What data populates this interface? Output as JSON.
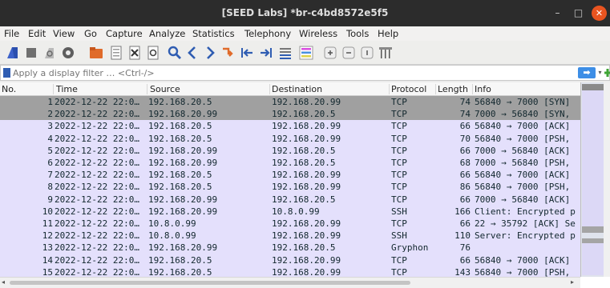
{
  "window": {
    "title": "[SEED Labs] *br-c4bd8572e5f5",
    "minimize_glyph": "–",
    "maximize_glyph": "□",
    "close_glyph": "✕"
  },
  "menu": [
    "File",
    "Edit",
    "View",
    "Go",
    "Capture",
    "Analyze",
    "Statistics",
    "Telephony",
    "Wireless",
    "Tools",
    "Help"
  ],
  "toolbar": {
    "icons": [
      "start-capture-icon",
      "stop-capture-icon",
      "restart-capture-icon",
      "capture-options-icon",
      "open-file-icon",
      "save-file-icon",
      "close-file-icon",
      "reload-file-icon",
      "find-packet-icon",
      "go-back-icon",
      "go-forward-icon",
      "go-to-packet-icon",
      "go-first-packet-icon",
      "go-last-packet-icon",
      "auto-scroll-icon",
      "colorize-icon",
      "zoom-in-icon",
      "zoom-out-icon",
      "normal-size-icon",
      "resize-columns-icon"
    ]
  },
  "filter": {
    "placeholder": "Apply a display filter … <Ctrl-/>",
    "value": "",
    "apply_glyph": "➡",
    "dropdown_glyph": "▾"
  },
  "packet_list": {
    "columns": [
      "No.",
      "Time",
      "Source",
      "Destination",
      "Protocol",
      "Length",
      "Info"
    ],
    "rows": [
      {
        "no": "1",
        "time": "2022-12-22 22:0…",
        "source": "192.168.20.5",
        "destination": "192.168.20.99",
        "protocol": "TCP",
        "length": "74",
        "info": "56840 → 7000 [SYN]",
        "selected": true
      },
      {
        "no": "2",
        "time": "2022-12-22 22:0…",
        "source": "192.168.20.99",
        "destination": "192.168.20.5",
        "protocol": "TCP",
        "length": "74",
        "info": "7000 → 56840 [SYN,",
        "selected": true
      },
      {
        "no": "3",
        "time": "2022-12-22 22:0…",
        "source": "192.168.20.5",
        "destination": "192.168.20.99",
        "protocol": "TCP",
        "length": "66",
        "info": "56840 → 7000 [ACK]"
      },
      {
        "no": "4",
        "time": "2022-12-22 22:0…",
        "source": "192.168.20.5",
        "destination": "192.168.20.99",
        "protocol": "TCP",
        "length": "70",
        "info": "56840 → 7000 [PSH,"
      },
      {
        "no": "5",
        "time": "2022-12-22 22:0…",
        "source": "192.168.20.99",
        "destination": "192.168.20.5",
        "protocol": "TCP",
        "length": "66",
        "info": "7000 → 56840 [ACK]"
      },
      {
        "no": "6",
        "time": "2022-12-22 22:0…",
        "source": "192.168.20.99",
        "destination": "192.168.20.5",
        "protocol": "TCP",
        "length": "68",
        "info": "7000 → 56840 [PSH,"
      },
      {
        "no": "7",
        "time": "2022-12-22 22:0…",
        "source": "192.168.20.5",
        "destination": "192.168.20.99",
        "protocol": "TCP",
        "length": "66",
        "info": "56840 → 7000 [ACK]"
      },
      {
        "no": "8",
        "time": "2022-12-22 22:0…",
        "source": "192.168.20.5",
        "destination": "192.168.20.99",
        "protocol": "TCP",
        "length": "86",
        "info": "56840 → 7000 [PSH,"
      },
      {
        "no": "9",
        "time": "2022-12-22 22:0…",
        "source": "192.168.20.99",
        "destination": "192.168.20.5",
        "protocol": "TCP",
        "length": "66",
        "info": "7000 → 56840 [ACK]"
      },
      {
        "no": "10",
        "time": "2022-12-22 22:0…",
        "source": "192.168.20.99",
        "destination": "10.8.0.99",
        "protocol": "SSH",
        "length": "166",
        "info": "Client: Encrypted p"
      },
      {
        "no": "11",
        "time": "2022-12-22 22:0…",
        "source": "10.8.0.99",
        "destination": "192.168.20.99",
        "protocol": "TCP",
        "length": "66",
        "info": "22 → 35792 [ACK] Se"
      },
      {
        "no": "12",
        "time": "2022-12-22 22:0…",
        "source": "10.8.0.99",
        "destination": "192.168.20.99",
        "protocol": "SSH",
        "length": "110",
        "info": "Server: Encrypted p"
      },
      {
        "no": "13",
        "time": "2022-12-22 22:0…",
        "source": "192.168.20.99",
        "destination": "192.168.20.5",
        "protocol": "Gryphon",
        "length": "76",
        "info": ""
      },
      {
        "no": "14",
        "time": "2022-12-22 22:0…",
        "source": "192.168.20.5",
        "destination": "192.168.20.99",
        "protocol": "TCP",
        "length": "66",
        "info": "56840 → 7000 [ACK]"
      },
      {
        "no": "15",
        "time": "2022-12-22 22:0…",
        "source": "192.168.20.5",
        "destination": "192.168.20.99",
        "protocol": "TCP",
        "length": "143",
        "info": "56840 → 7000 [PSH,"
      }
    ]
  },
  "colors": {
    "titlebar": "#2c2c2c",
    "close_button": "#e95420",
    "row_tcp": "#e4e0fc",
    "row_selected": "#a0a0a0",
    "apply_button": "#3d8ee6",
    "shark_fin": "#3d62c9"
  }
}
